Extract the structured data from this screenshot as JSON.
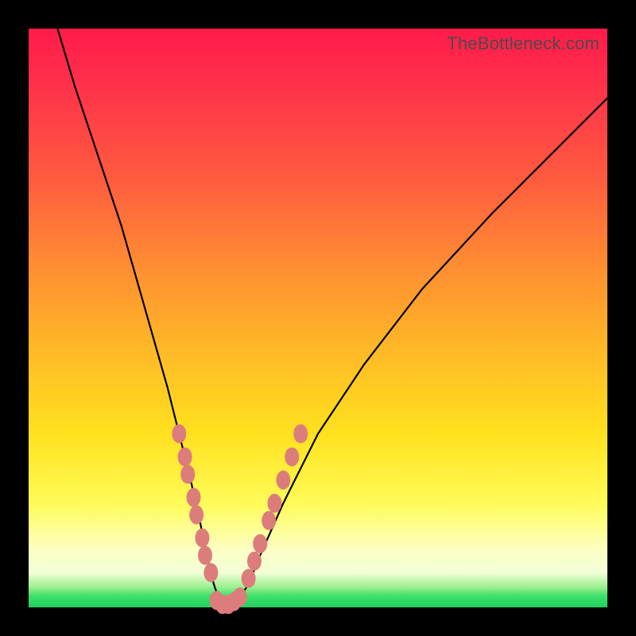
{
  "watermark": "TheBottleneck.com",
  "colors": {
    "frame": "#000000",
    "gradient_top": "#ff1b4a",
    "gradient_mid": "#ffe11e",
    "gradient_bottom": "#1fd05f",
    "curve": "#000000",
    "beads": "#dd7d7b"
  },
  "chart_data": {
    "type": "line",
    "title": "",
    "xlabel": "",
    "ylabel": "",
    "xlim": [
      0,
      100
    ],
    "ylim": [
      0,
      100
    ],
    "grid": false,
    "legend": false,
    "series": [
      {
        "name": "bottleneck-curve",
        "x": [
          5,
          8,
          12,
          16,
          20,
          24,
          26,
          28,
          30,
          31,
          32,
          33,
          34,
          35,
          36,
          38,
          40,
          44,
          50,
          58,
          68,
          80,
          92,
          100
        ],
        "y": [
          100,
          90,
          78,
          66,
          52,
          38,
          30,
          22,
          13,
          8,
          4,
          1,
          0,
          0,
          1,
          4,
          9,
          18,
          30,
          42,
          55,
          68,
          80,
          88
        ]
      }
    ],
    "annotations": {
      "beads_left_arm": [
        {
          "x": 26,
          "y": 30
        },
        {
          "x": 27,
          "y": 26
        },
        {
          "x": 27.5,
          "y": 23
        },
        {
          "x": 28.5,
          "y": 19
        },
        {
          "x": 29,
          "y": 16
        },
        {
          "x": 30,
          "y": 12
        },
        {
          "x": 30.5,
          "y": 9
        },
        {
          "x": 31.5,
          "y": 6
        }
      ],
      "beads_bottom": [
        {
          "x": 32.5,
          "y": 1.2
        },
        {
          "x": 33.5,
          "y": 0.5
        },
        {
          "x": 34.5,
          "y": 0.5
        },
        {
          "x": 35.5,
          "y": 1.0
        },
        {
          "x": 36.5,
          "y": 1.8
        }
      ],
      "beads_right_arm": [
        {
          "x": 38,
          "y": 5
        },
        {
          "x": 39,
          "y": 8
        },
        {
          "x": 40,
          "y": 11
        },
        {
          "x": 41.5,
          "y": 15
        },
        {
          "x": 42.5,
          "y": 18
        },
        {
          "x": 44,
          "y": 22
        },
        {
          "x": 45.5,
          "y": 26
        },
        {
          "x": 47,
          "y": 30
        }
      ]
    }
  }
}
